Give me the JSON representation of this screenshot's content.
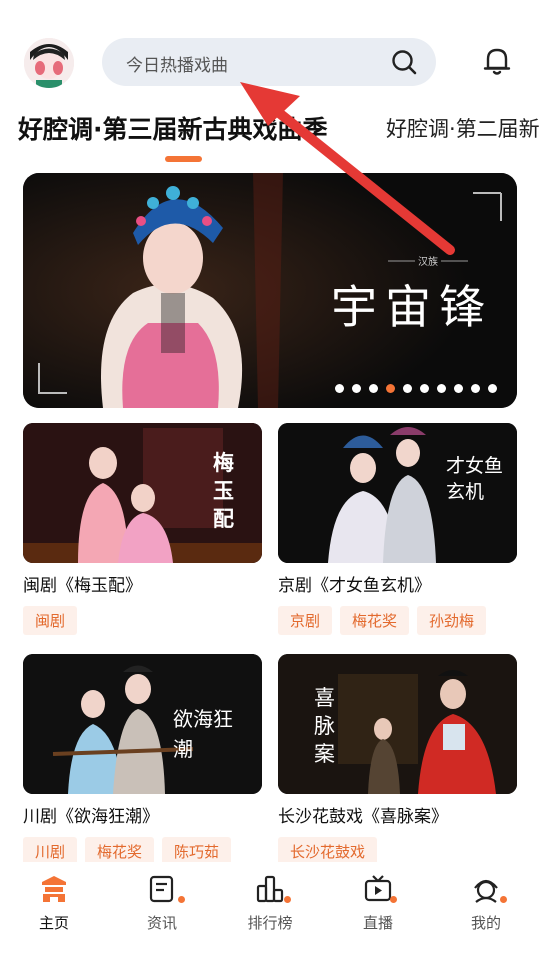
{
  "search": {
    "placeholder": "今日热播戏曲"
  },
  "tabs": [
    {
      "label": "好腔调·第三届新古典戏曲季",
      "active": true
    },
    {
      "label": "好腔调·第二届新古",
      "active": false
    }
  ],
  "banner": {
    "title": "宇宙锋",
    "subtitle": "汉族",
    "dot_count": 10,
    "active_dot": 3
  },
  "cards": [
    {
      "title": "闽剧《梅玉配》",
      "calligraphy": "梅玉配",
      "tags": [
        "闽剧"
      ]
    },
    {
      "title": "京剧《才女鱼玄机》",
      "calligraphy": "才女鱼玄机",
      "tags": [
        "京剧",
        "梅花奖",
        "孙劲梅"
      ]
    },
    {
      "title": "川剧《欲海狂潮》",
      "calligraphy": "欲海狂潮",
      "tags": [
        "川剧",
        "梅花奖",
        "陈巧茹"
      ]
    },
    {
      "title": "长沙花鼓戏《喜脉案》",
      "calligraphy": "喜脉案",
      "tags": [
        "长沙花鼓戏"
      ]
    }
  ],
  "nav": [
    {
      "label": "主页",
      "icon": "home-icon",
      "active": true
    },
    {
      "label": "资讯",
      "icon": "news-icon",
      "active": false
    },
    {
      "label": "排行榜",
      "icon": "ranking-icon",
      "active": false
    },
    {
      "label": "直播",
      "icon": "live-icon",
      "active": false
    },
    {
      "label": "我的",
      "icon": "profile-icon",
      "active": false
    }
  ],
  "colors": {
    "accent": "#f47436",
    "annotation": "#e53935",
    "search_bg": "#e9edf3"
  }
}
